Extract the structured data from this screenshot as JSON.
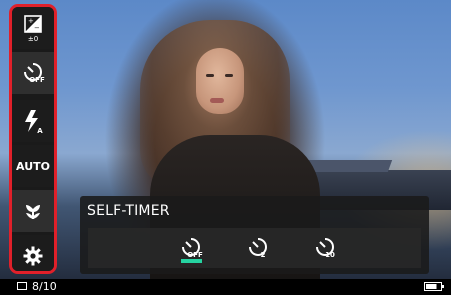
{
  "sidebar": {
    "items": [
      {
        "name": "exposure-compensation",
        "label": "±0"
      },
      {
        "name": "self-timer",
        "label": "OFF"
      },
      {
        "name": "flash",
        "label": "A"
      },
      {
        "name": "auto-mode",
        "label": "AUTO"
      },
      {
        "name": "macro",
        "label": ""
      },
      {
        "name": "settings",
        "label": ""
      }
    ]
  },
  "panel": {
    "title": "SELF-TIMER",
    "options": [
      {
        "name": "self-timer-off",
        "label": "OFF",
        "selected": true
      },
      {
        "name": "self-timer-2s",
        "label": "2",
        "selected": false
      },
      {
        "name": "self-timer-10s",
        "label": "10",
        "selected": false
      }
    ],
    "selected_color": "#26d3a1"
  },
  "status": {
    "shots": "8/10",
    "battery_level": 0.75
  },
  "colors": {
    "highlight_border": "#e0202a",
    "accent": "#26d3a1"
  }
}
